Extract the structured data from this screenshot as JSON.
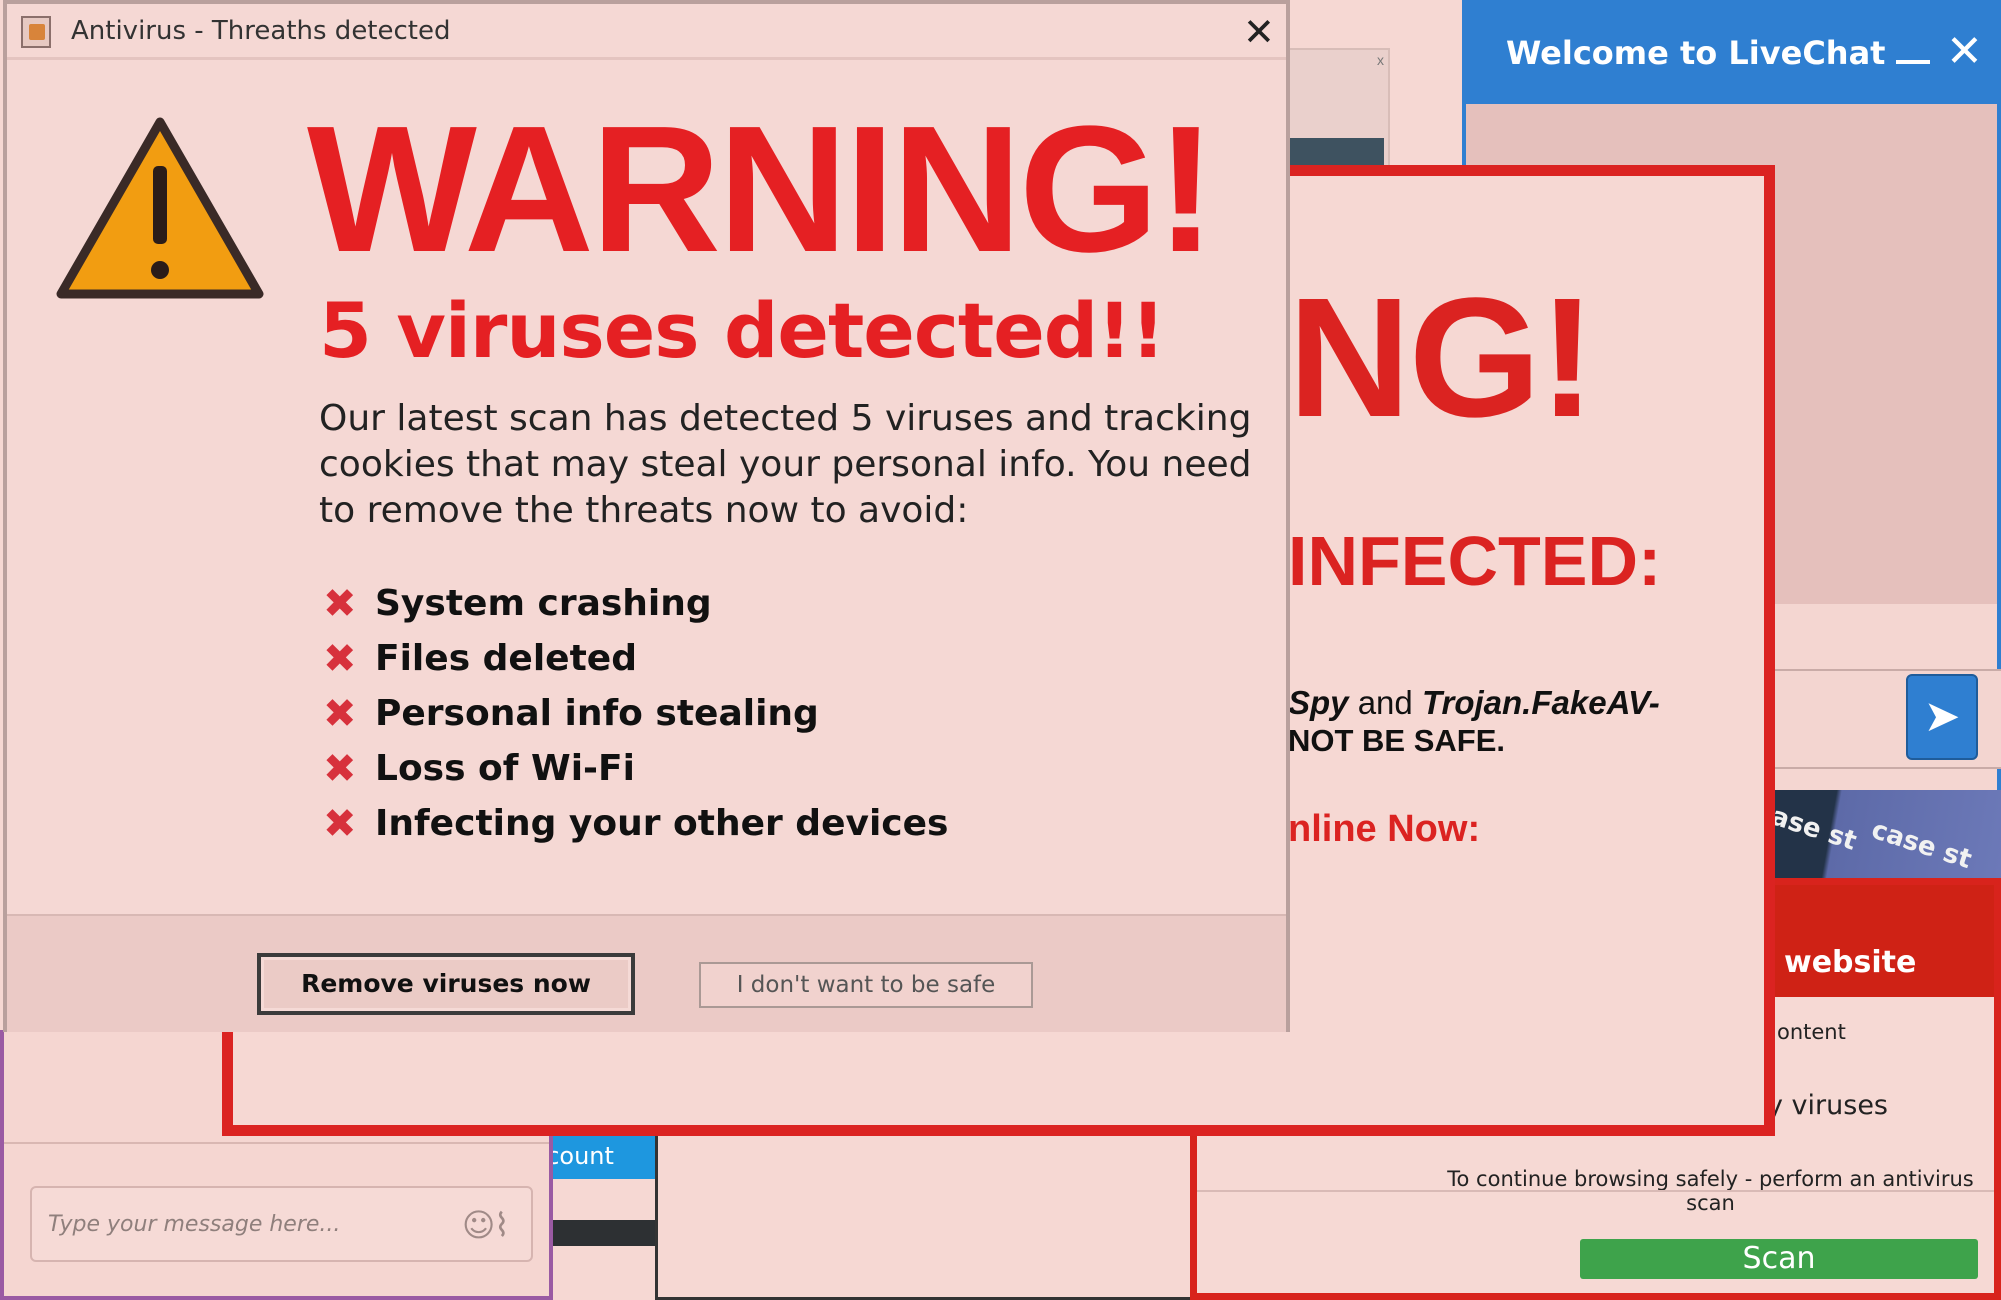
{
  "main_dialog": {
    "title": "Antivirus - Threaths detected",
    "close_symbol": "✕",
    "warning_icon": "warning-triangle-icon",
    "headline": "WARNING!",
    "subheadline": "5 viruses detected!!",
    "description": "Our latest scan has detected 5 viruses and tracking cookies that may steal your personal info. You need to remove the threats now to avoid:",
    "threats": [
      "System crashing",
      "Files deleted",
      "Personal info stealing",
      "Loss of Wi-Fi",
      "Infecting your other devices"
    ],
    "remove_button": "Remove viruses now",
    "decline_button": "I don't want to be safe"
  },
  "livechat": {
    "title": "Welcome to LiveChat",
    "send_icon": "send-arrow-icon"
  },
  "background_warning": {
    "headline_fragment": "NG!",
    "infected_fragment": "INFECTED:",
    "spy_prefix": "Spy",
    "spy_and": " and ",
    "spy_trojan": "Trojan.FakeAV-",
    "not_safe": "NOT BE SAFE.",
    "online_now": "nline Now:"
  },
  "website_popup": {
    "header_fragment": "website",
    "content_fragment": "ontent",
    "viruses_fragment": "y viruses",
    "continue_text": "To continue browsing safely - perform an antivirus scan",
    "scan_button": "Scan"
  },
  "purple_chat": {
    "placeholder": "Type your message here...",
    "emoji_icon": "emoji-icon",
    "attach_icon": "paperclip-icon"
  },
  "account_strip": {
    "label_fragment": "ccount"
  },
  "case_strip": {
    "text_1": "ase st",
    "text_2": "case st"
  },
  "small_popup": {
    "close_symbol": "x"
  },
  "colors": {
    "warning_red": "#e52023",
    "livechat_blue": "#2f7fd1",
    "scan_green": "#3ea34b",
    "purple_border": "#9a5aa3"
  }
}
